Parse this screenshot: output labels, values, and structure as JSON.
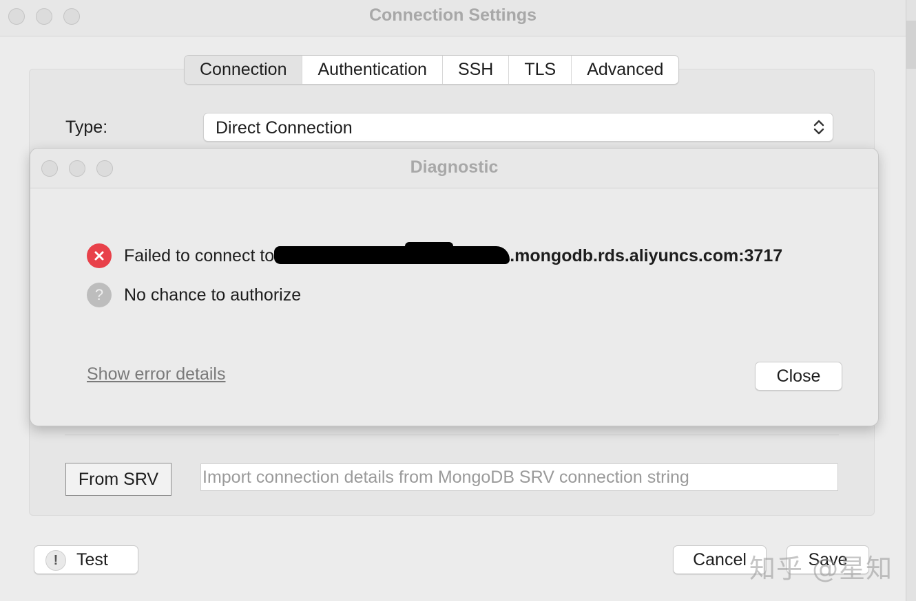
{
  "window": {
    "title": "Connection Settings"
  },
  "tabs": [
    {
      "label": "Connection",
      "selected": true
    },
    {
      "label": "Authentication",
      "selected": false
    },
    {
      "label": "SSH",
      "selected": false
    },
    {
      "label": "TLS",
      "selected": false
    },
    {
      "label": "Advanced",
      "selected": false
    }
  ],
  "connection": {
    "type_label": "Type:",
    "type_value": "Direct Connection",
    "from_srv_label": "From SRV",
    "srv_placeholder": "Import connection details from MongoDB SRV connection string"
  },
  "footer": {
    "test_label": "Test",
    "cancel_label": "Cancel",
    "save_label": "Save"
  },
  "dialog": {
    "title": "Diagnostic",
    "messages": [
      {
        "status": "error",
        "icon": "error-icon",
        "prefix": "Failed to connect to",
        "host": ".mongodb.rds.aliyuncs.com:3717"
      },
      {
        "status": "unknown",
        "icon": "question-icon",
        "text": "No chance to authorize"
      }
    ],
    "details_link": "Show error details",
    "close_label": "Close"
  },
  "watermark": "知乎 @星知",
  "colors": {
    "error": "#e8414a",
    "unknown": "#bdbdbd",
    "title_gray": "#a8a8a8"
  }
}
